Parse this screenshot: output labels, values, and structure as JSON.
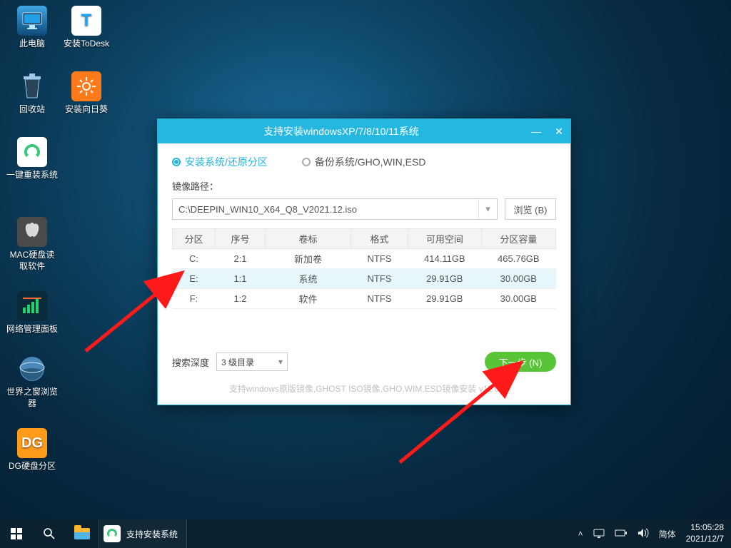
{
  "desktop": {
    "icons": {
      "pc": "此电脑",
      "todesk": "安装ToDesk",
      "recycle": "回收站",
      "sunflower": "安装向日葵",
      "reinstall": "一键重装系统",
      "mac": "MAC硬盘读取软件",
      "netpanel": "网络管理面板",
      "world": "世界之窗浏览器",
      "dg": "DG硬盘分区"
    }
  },
  "win": {
    "title": "支持安装windowsXP/7/8/10/11系统",
    "tab_install": "安装系统/还原分区",
    "tab_backup": "备份系统/GHO,WIN,ESD",
    "path_label": "镜像路径：",
    "path_value": "C:\\DEEPIN_WIN10_X64_Q8_V2021.12.iso",
    "browse": "浏览 (B)",
    "cols": [
      "分区",
      "序号",
      "卷标",
      "格式",
      "可用空间",
      "分区容量"
    ],
    "rows": [
      {
        "part": "C:",
        "seq": "2:1",
        "label": "新加卷",
        "fmt": "NTFS",
        "free": "414.11GB",
        "size": "465.76GB"
      },
      {
        "part": "E:",
        "seq": "1:1",
        "label": "系统",
        "fmt": "NTFS",
        "free": "29.91GB",
        "size": "30.00GB"
      },
      {
        "part": "F:",
        "seq": "1:2",
        "label": "软件",
        "fmt": "NTFS",
        "free": "29.91GB",
        "size": "30.00GB"
      }
    ],
    "depth_label": "搜索深度",
    "depth_value": "3 级目录",
    "next": "下一步 (N)",
    "footer": "支持windows原版镜像,GHOST ISO镜像,GHO,WIM,ESD镜像安装 v11.0"
  },
  "taskbar": {
    "active_task": "支持安装系统",
    "ime": "简体",
    "time": "15:05:28",
    "date": "2021/12/7"
  }
}
